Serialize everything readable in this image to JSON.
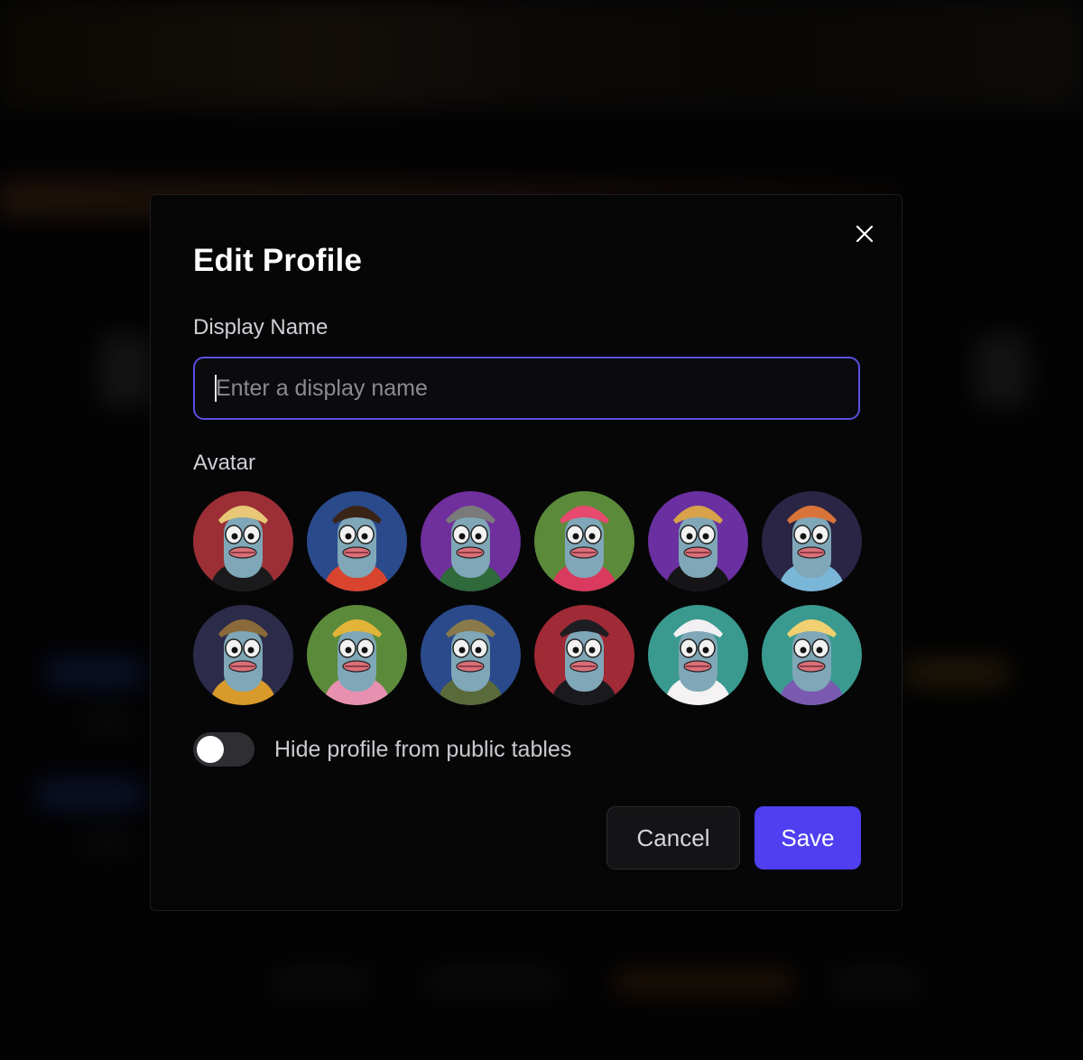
{
  "modal": {
    "title": "Edit Profile",
    "display_name_label": "Display Name",
    "display_name_value": "",
    "display_name_placeholder": "Enter a display name",
    "avatar_label": "Avatar",
    "toggle_label": "Hide profile from public tables",
    "toggle_on": false,
    "cancel_label": "Cancel",
    "save_label": "Save",
    "accent_color": "#4f3ff0",
    "focus_border_color": "#5b4fe0"
  },
  "avatars": [
    {
      "bg": "#9b2f35",
      "hat": "blonde-bun",
      "outfit": "tuxedo"
    },
    {
      "bg": "#2a4a8c",
      "hat": "dreadlocks",
      "outfit": "red-jacket-gold-chain"
    },
    {
      "bg": "#6f2f9c",
      "hat": "grey-beanie",
      "outfit": "green-plaid-glasses"
    },
    {
      "bg": "#5b8a3a",
      "hat": "pink-bucket-hat",
      "outfit": "pink-jacket"
    },
    {
      "bg": "#6a2fa0",
      "hat": "bandana",
      "outfit": "black-hoodie"
    },
    {
      "bg": "#2a2545",
      "hat": "orange-headwrap",
      "outfit": "tie-dye"
    },
    {
      "bg": "#2c2b4a",
      "hat": "cowboy-hat",
      "outfit": "floral-shirt"
    },
    {
      "bg": "#5b8a3a",
      "hat": "crown",
      "outfit": "pink-fur-coat"
    },
    {
      "bg": "#2a4a8c",
      "hat": "plaid-cap",
      "outfit": "olive-jacket"
    },
    {
      "bg": "#a02a35",
      "hat": "baseball-cap",
      "outfit": "black-jacket-chain"
    },
    {
      "bg": "#3a9a8f",
      "hat": "white-cat-hair",
      "outfit": "maid-bow"
    },
    {
      "bg": "#3a9a8f",
      "hat": "blonde-visor",
      "outfit": "purple-dress"
    }
  ],
  "icons": {
    "close": "close-icon"
  }
}
